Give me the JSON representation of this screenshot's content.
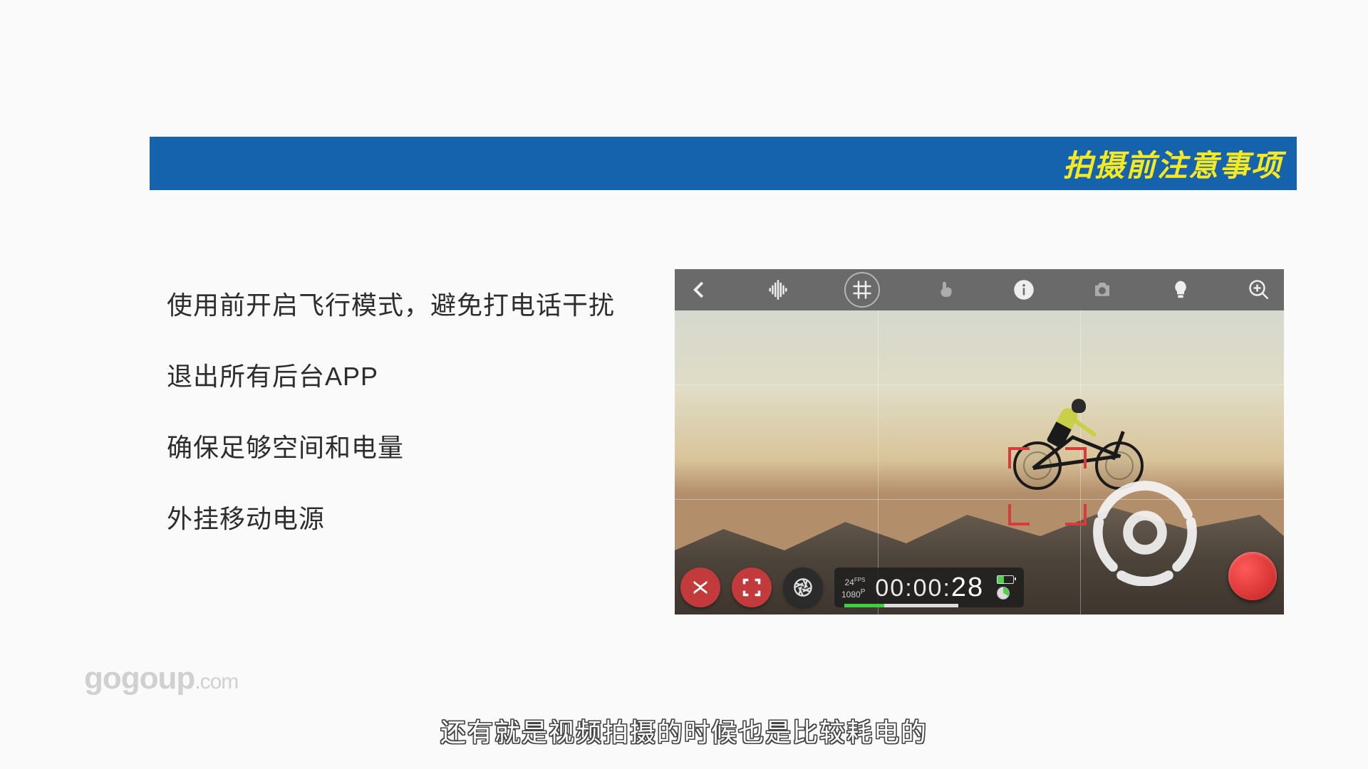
{
  "banner": {
    "title": "拍摄前注意事项"
  },
  "bullets": [
    "使用前开启飞行模式，避免打电话干扰",
    "退出所有后台APP",
    "确保足够空间和电量",
    "外挂移动电源"
  ],
  "camera": {
    "fps": "24",
    "fps_suffix": "FPS",
    "res": "1080",
    "res_suffix": "P",
    "time_prefix": "00:00:",
    "time_seconds": "28"
  },
  "watermark": {
    "brand": "gogoup",
    "suffix": ".com"
  },
  "subtitle": "还有就是视频拍摄的时候也是比较耗电的"
}
